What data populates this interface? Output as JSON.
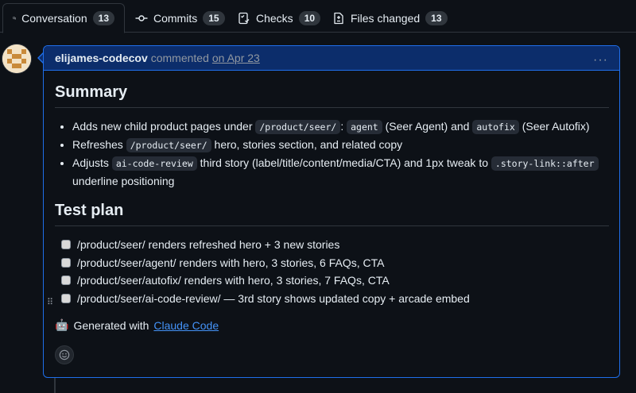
{
  "tabs": [
    {
      "label": "Conversation",
      "count": "13",
      "icon": "comment-discussion-icon"
    },
    {
      "label": "Commits",
      "count": "15",
      "icon": "git-commit-icon"
    },
    {
      "label": "Checks",
      "count": "10",
      "icon": "checklist-icon"
    },
    {
      "label": "Files changed",
      "count": "13",
      "icon": "file-diff-icon"
    }
  ],
  "comment": {
    "author": "elijames-codecov",
    "action": "commented",
    "date": "on Apr 23",
    "more_menu": "···"
  },
  "summary": {
    "heading": "Summary",
    "bullets": [
      {
        "prefix": "Adds new child product pages under ",
        "code1": "/product/seer/",
        "colon": ": ",
        "code2": "agent",
        "mid": " (Seer Agent) and ",
        "code3": "autofix",
        "suffix": " (Seer Autofix)"
      },
      {
        "prefix": "Refreshes ",
        "code1": "/product/seer/",
        "suffix": " hero, stories section, and related copy"
      },
      {
        "prefix": "Adjusts ",
        "code1": "ai-code-review",
        "mid": " third story (label/title/content/media/CTA) and 1px tweak to ",
        "code2": ".story-link::after",
        "suffix": " underline positioning"
      }
    ]
  },
  "test_plan": {
    "heading": "Test plan",
    "items": [
      "/product/seer/ renders refreshed hero + 3 new stories",
      "/product/seer/agent/ renders with hero, 3 stories, 6 FAQs, CTA",
      "/product/seer/autofix/ renders with hero, 3 stories, 7 FAQs, CTA",
      "/product/seer/ai-code-review/ — 3rd story shows updated copy + arcade embed"
    ]
  },
  "footer": {
    "emoji": "🤖",
    "generated_prefix": "Generated with",
    "link_text": "Claude Code"
  },
  "colors": {
    "accent": "#1f6feb",
    "header_bg": "#0c2d6b",
    "link": "#4493f8"
  }
}
